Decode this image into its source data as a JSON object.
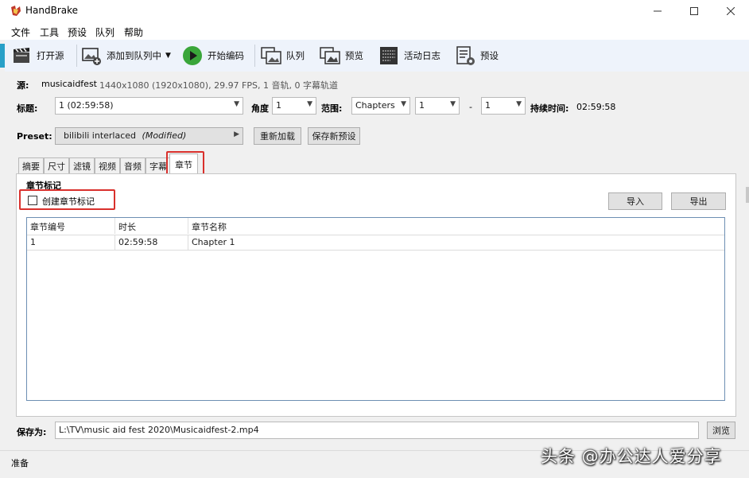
{
  "window": {
    "title": "HandBrake"
  },
  "menu": [
    "文件",
    "工具",
    "预设",
    "队列",
    "帮助"
  ],
  "toolbar": {
    "open_source": "打开源",
    "add_to_queue": "添加到队列中",
    "start_encode": "开始编码",
    "queue": "队列",
    "preview": "预览",
    "activity_log": "活动日志",
    "presets": "预设"
  },
  "source": {
    "label": "源:",
    "name": "musicaidfest",
    "info": "1440x1080 (1920x1080), 29.97 FPS, 1 音轨, 0 字幕轨道"
  },
  "title_row": {
    "title_label": "标题:",
    "title_value": "1  (02:59:58)",
    "angle_label": "角度",
    "angle_value": "1",
    "range_label": "范围:",
    "range_type": "Chapters",
    "range_start": "1",
    "dash": "-",
    "range_end": "1",
    "duration_label": "持续时间:",
    "duration_value": "02:59:58"
  },
  "preset": {
    "label": "Preset:",
    "name": "bilibili interlaced",
    "modified": "(Modified)",
    "reload": "重新加载",
    "save_new": "保存新预设"
  },
  "tabs": [
    "摘要",
    "尺寸",
    "滤镜",
    "视频",
    "音频",
    "字幕",
    "章节"
  ],
  "active_tab": "章节",
  "chapters": {
    "section_title": "章节标记",
    "create_markers": "创建章节标记",
    "create_markers_checked": false,
    "import": "导入",
    "export": "导出",
    "columns": [
      "章节编号",
      "时长",
      "章节名称"
    ],
    "rows": [
      [
        "1",
        "02:59:58",
        "Chapter 1"
      ]
    ]
  },
  "save": {
    "label": "保存为:",
    "path": "L:\\TV\\music aid fest 2020\\Musicaidfest-2.mp4",
    "browse": "浏览"
  },
  "status": {
    "text": "准备"
  },
  "watermark": "头条 @办公达人爱分享",
  "colors": {
    "highlight": "#d9302c",
    "play": "#3aa63a",
    "toolbar_bg": "#eef3fb"
  }
}
